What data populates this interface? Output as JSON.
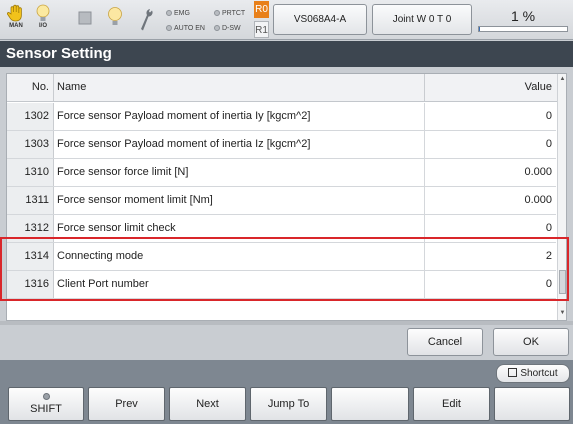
{
  "status_bar": {
    "icons": [
      {
        "name": "hand-icon",
        "caption": "MAN"
      },
      {
        "name": "io-lamp-icon",
        "caption": "I/O"
      },
      {
        "name": "stop-square-icon",
        "caption": ""
      },
      {
        "name": "lamp-icon",
        "caption": ""
      },
      {
        "name": "wrench-icon",
        "caption": ""
      }
    ],
    "indicators": {
      "emg": "EMG",
      "prtct": "PRTCT",
      "auto_en": "AUTO EN",
      "dsw": "D-SW"
    },
    "r0_label": "R0",
    "r1_label": "R1",
    "robot_model": "VS068A4-A",
    "joint_mode": "Joint  W 0 T 0",
    "speed_label": "1 %",
    "speed_fraction": 0.01,
    "accent_color": "#e8801a"
  },
  "title": "Sensor Setting",
  "table": {
    "columns": {
      "no": "No.",
      "name": "Name",
      "value": "Value"
    },
    "rows": [
      {
        "no": "1302",
        "name": "Force sensor Payload moment of inertia Iy [kgcm^2]",
        "value": "0"
      },
      {
        "no": "1303",
        "name": "Force sensor Payload moment of inertia Iz [kgcm^2]",
        "value": "0"
      },
      {
        "no": "1310",
        "name": "Force sensor force limit [N]",
        "value": "0.000"
      },
      {
        "no": "1311",
        "name": "Force sensor moment limit [Nm]",
        "value": "0.000"
      },
      {
        "no": "1312",
        "name": "Force sensor limit check",
        "value": "0"
      },
      {
        "no": "1314",
        "name": "Connecting mode",
        "value": "2"
      },
      {
        "no": "1316",
        "name": "Client Port number",
        "value": "0"
      }
    ],
    "highlight_color": "#d9262a"
  },
  "dialog": {
    "cancel_label": "Cancel",
    "ok_label": "OK"
  },
  "footer": {
    "shortcut_label": "Shortcut",
    "keys": {
      "shift": "SHIFT",
      "prev": "Prev",
      "next": "Next",
      "jump_to": "Jump To",
      "empty_5": "",
      "edit": "Edit",
      "empty_7": ""
    }
  }
}
